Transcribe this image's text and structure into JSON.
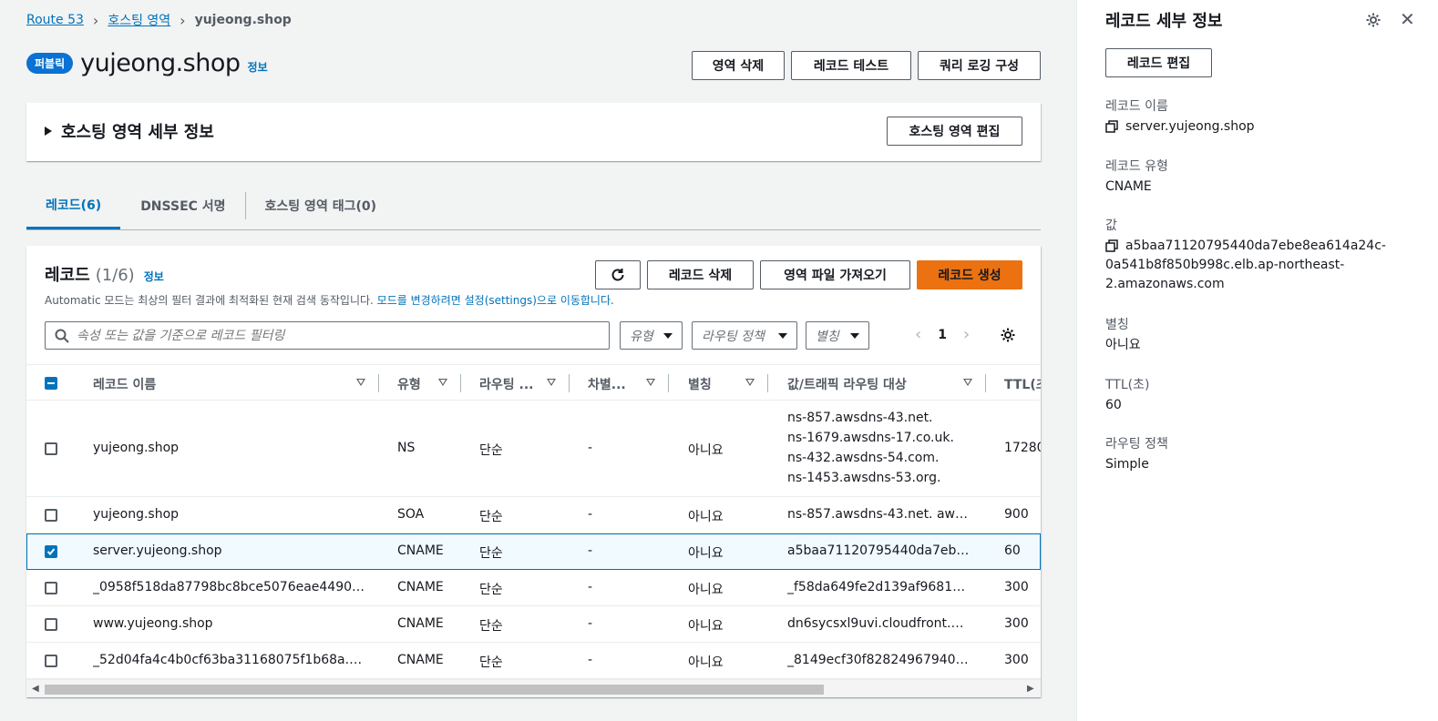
{
  "breadcrumb": {
    "items": [
      "Route 53",
      "호스팅 영역"
    ],
    "current": "yujeong.shop"
  },
  "header": {
    "badge": "퍼블릭",
    "title": "yujeong.shop",
    "info": "정보",
    "buttons": {
      "delete_zone": "영역 삭제",
      "test_record": "레코드 테스트",
      "query_logging": "쿼리 로깅 구성"
    }
  },
  "zone_details": {
    "label": "호스팅 영역 세부 정보",
    "edit_button": "호스팅 영역 편집"
  },
  "tabs": [
    {
      "label": "레코드(6)",
      "active": true
    },
    {
      "label": "DNSSEC 서명",
      "active": false
    },
    {
      "label": "호스팅 영역 태그(0)",
      "active": false
    }
  ],
  "records": {
    "title": "레코드",
    "count": "(1/6)",
    "info": "정보",
    "description_prefix": "Automatic 모드는 최상의 필터 결과에 최적화된 현재 검색 동작입니다.",
    "description_link": "모드를 변경하려면 설정(settings)으로 이동합니다.",
    "buttons": {
      "delete": "레코드 삭제",
      "import": "영역 파일 가져오기",
      "create": "레코드 생성"
    },
    "search_placeholder": "속성 또는 값을 기준으로 레코드 필터링",
    "filters": [
      "유형",
      "라우팅 정책",
      "별칭"
    ],
    "page": "1",
    "columns": [
      "레코드 이름",
      "유형",
      "라우팅 ...",
      "차별...",
      "별칭",
      "값/트래픽 라우팅 대상",
      "TTL(초"
    ],
    "rows": [
      {
        "name": "yujeong.shop",
        "type": "NS",
        "routing": "단순",
        "diff": "-",
        "alias": "아니요",
        "value": [
          "ns-857.awsdns-43.net.",
          "ns-1679.awsdns-17.co.uk.",
          "ns-432.awsdns-54.com.",
          "ns-1453.awsdns-53.org."
        ],
        "ttl": "17280",
        "selected": false
      },
      {
        "name": "yujeong.shop",
        "type": "SOA",
        "routing": "단순",
        "diff": "-",
        "alias": "아니요",
        "value": [
          "ns-857.awsdns-43.net. awsd..."
        ],
        "ttl": "900",
        "selected": false
      },
      {
        "name": "server.yujeong.shop",
        "type": "CNAME",
        "routing": "단순",
        "diff": "-",
        "alias": "아니요",
        "value": [
          "a5baa71120795440da7ebe8..."
        ],
        "ttl": "60",
        "selected": true
      },
      {
        "name": "_0958f518da87798bc8bce5076eae4490.ser...",
        "type": "CNAME",
        "routing": "단순",
        "diff": "-",
        "alias": "아니요",
        "value": [
          "_f58da649fe2d139af968107..."
        ],
        "ttl": "300",
        "selected": false
      },
      {
        "name": "www.yujeong.shop",
        "type": "CNAME",
        "routing": "단순",
        "diff": "-",
        "alias": "아니요",
        "value": [
          "dn6sycsxl9uvi.cloudfront.net"
        ],
        "ttl": "300",
        "selected": false
      },
      {
        "name": "_52d04fa4c4b0cf63ba31168075f1b68a.ww...",
        "type": "CNAME",
        "routing": "단순",
        "diff": "-",
        "alias": "아니요",
        "value": [
          "_8149ecf30f828249679400..."
        ],
        "ttl": "300",
        "selected": false
      }
    ]
  },
  "side_panel": {
    "title": "레코드 세부 정보",
    "edit_button": "레코드 편집",
    "fields": {
      "name_label": "레코드 이름",
      "name_value": "server.yujeong.shop",
      "type_label": "레코드 유형",
      "type_value": "CNAME",
      "value_label": "값",
      "value_lines": [
        "a5baa71120795440da7ebe8ea614a24c-",
        "0a541b8f850b998c.elb.ap-northeast-",
        "2.amazonaws.com"
      ],
      "alias_label": "별칭",
      "alias_value": "아니요",
      "ttl_label": "TTL(초)",
      "ttl_value": "60",
      "routing_label": "라우팅 정책",
      "routing_value": "Simple"
    }
  },
  "colors": {
    "link": "#0073bb",
    "primary_button": "#ec7211",
    "badge": "#0972d3"
  }
}
